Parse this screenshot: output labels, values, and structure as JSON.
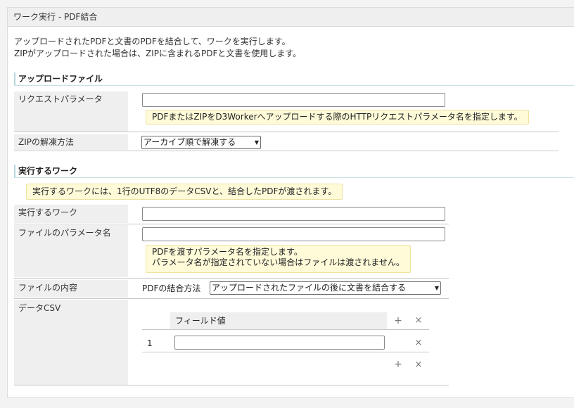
{
  "header": {
    "title": "ワーク実行 - PDF結合"
  },
  "description": {
    "line1": "アップロードされたPDFと文書のPDFを結合して、ワークを実行します。",
    "line2": "ZIPがアップロードされた場合は、ZIPに含まれるPDFと文書を使用します。"
  },
  "upload": {
    "title": "アップロードファイル",
    "request_param": {
      "label": "リクエストパラメータ",
      "value": "",
      "hint": "PDFまたはZIPをD3Workerへアップロードする際のHTTPリクエストパラメータ名を指定します。"
    },
    "zip_extract": {
      "label": "ZIPの解凍方法",
      "selected": "アーカイブ順で解凍する"
    }
  },
  "work": {
    "title": "実行するワーク",
    "note": "実行するワークには、1行のUTF8のデータCSVと、結合したPDFが渡されます。",
    "work_field": {
      "label": "実行するワーク",
      "value": ""
    },
    "file_param": {
      "label": "ファイルのパラメータ名",
      "value": "",
      "hint_line1": "PDFを渡すパラメータ名を指定します。",
      "hint_line2": "パラメータ名が指定されていない場合はファイルは渡されません。"
    },
    "file_content": {
      "label": "ファイルの内容",
      "method_label": "PDFの結合方法",
      "selected": "アップロードされたファイルの後に文書を結合する"
    },
    "data_csv": {
      "label": "データCSV",
      "column_header": "フィールド値",
      "rows": [
        {
          "index": "1",
          "value": ""
        }
      ]
    }
  },
  "icons": {
    "add": "+",
    "remove": "×"
  }
}
